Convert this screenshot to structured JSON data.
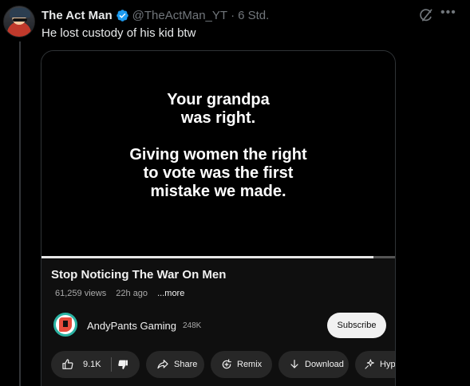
{
  "tweet": {
    "display_name": "The Act Man",
    "handle": "@TheActMan_YT",
    "separator": "·",
    "time": "6 Std.",
    "text": "He lost custody of his kid btw"
  },
  "video": {
    "overlay_lines_1": [
      "Your grandpa",
      "was right."
    ],
    "overlay_lines_2": [
      "Giving women the right",
      "to vote was the first",
      "mistake we made."
    ],
    "progress": 0.94,
    "title": "Stop Noticing The War On Men",
    "views": "61,259 views",
    "age": "22h ago",
    "more": "...more"
  },
  "channel": {
    "name": "AndyPants Gaming",
    "subscribers": "248K",
    "subscribe_label": "Subscribe"
  },
  "actions": {
    "like_count": "9.1K",
    "share_label": "Share",
    "remix_label": "Remix",
    "download_label": "Download",
    "hype_label": "Hype"
  },
  "colors": {
    "verified": "#1d9bf0",
    "background": "#000000",
    "panel": "#0f0f0f",
    "pill": "#272727"
  },
  "icons": [
    "verified-badge-icon",
    "grok-icon",
    "more-icon",
    "thumbs-up-icon",
    "thumbs-down-icon",
    "share-icon",
    "remix-icon",
    "download-icon",
    "hype-icon"
  ]
}
